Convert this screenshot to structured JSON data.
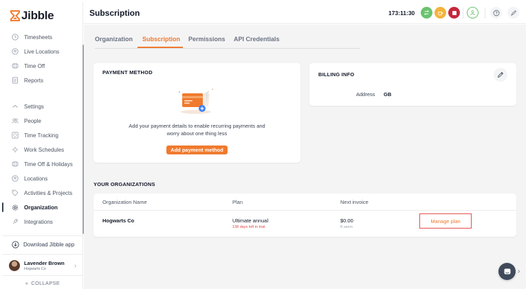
{
  "app": {
    "name": "Jibble"
  },
  "sidebar": {
    "items": [
      {
        "label": "Timesheets",
        "icon": "clock-icon"
      },
      {
        "label": "Live Locations",
        "icon": "location-pin-icon"
      },
      {
        "label": "Time Off",
        "icon": "time-off-icon"
      },
      {
        "label": "Reports",
        "icon": "reports-icon"
      },
      {
        "label": "Settings",
        "icon": "chevron-up-icon"
      },
      {
        "label": "People",
        "icon": "people-icon"
      },
      {
        "label": "Time Tracking",
        "icon": "time-tracking-icon"
      },
      {
        "label": "Work Schedules",
        "icon": "schedule-icon"
      },
      {
        "label": "Time Off & Holidays",
        "icon": "holidays-icon"
      },
      {
        "label": "Locations",
        "icon": "location-pin-icon"
      },
      {
        "label": "Activities & Projects",
        "icon": "tag-icon"
      },
      {
        "label": "Organization",
        "icon": "gear-icon",
        "active": true
      },
      {
        "label": "Integrations",
        "icon": "plug-icon"
      }
    ],
    "download_label": "Download Jibble app",
    "user": {
      "name": "Lavender Brown",
      "org": "Hogwarts Co"
    },
    "collapse_label": "COLLAPSE"
  },
  "header": {
    "title": "Subscription",
    "timer": "173:11:30",
    "colors": {
      "green": "#6ac36e",
      "yellow": "#f5b33c",
      "red": "#c5283d",
      "orange": "#f07a2e"
    }
  },
  "tabs": [
    {
      "label": "Organization"
    },
    {
      "label": "Subscription",
      "active": true
    },
    {
      "label": "Permissions"
    },
    {
      "label": "API Credentials"
    }
  ],
  "payment_method": {
    "title": "PAYMENT METHOD",
    "description_line1": "Add your payment details to enable recurring payments and",
    "description_line2": "worry about one thing less",
    "button_label": "Add payment method"
  },
  "billing_info": {
    "title": "BILLING INFO",
    "address_label": "Address",
    "address_value": "GB"
  },
  "organizations": {
    "title": "YOUR ORGANIZATIONS",
    "columns": [
      "Organization Name",
      "Plan",
      "Next invoice"
    ],
    "rows": [
      {
        "name": "Hogwarts Co",
        "plan": "Ultimate annual",
        "plan_note": "138 days left in trial.",
        "invoice": "$0.00",
        "invoice_note": "8 users",
        "action": "Manage plan"
      }
    ]
  }
}
